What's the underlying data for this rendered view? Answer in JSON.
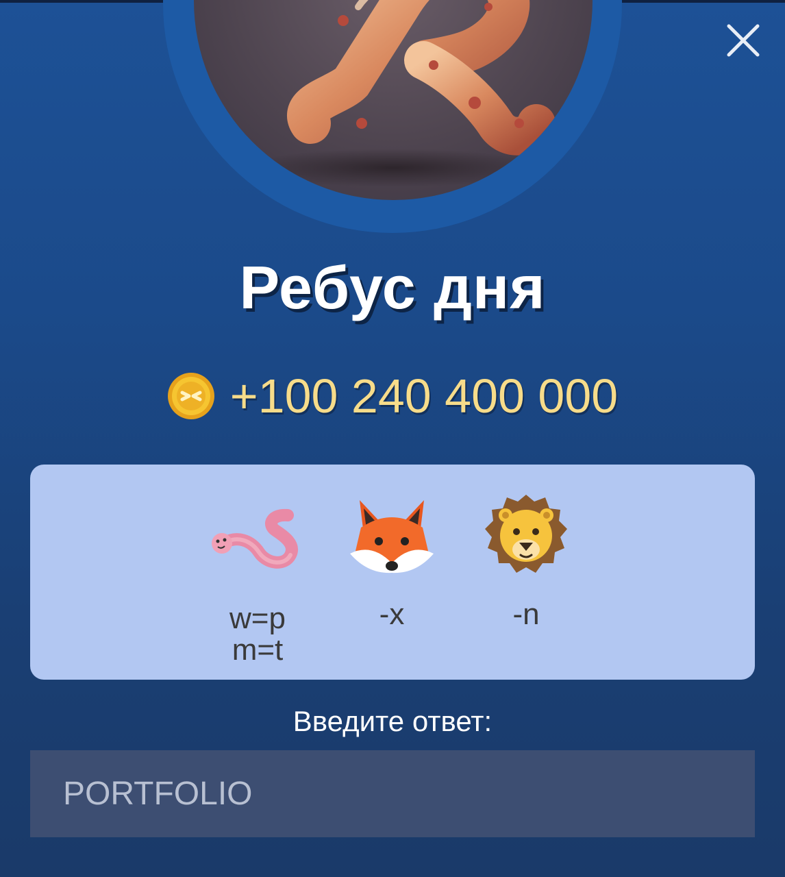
{
  "dialog": {
    "title": "Ребус дня",
    "reward_amount": "+100 240 400 000",
    "answer_label": "Введите ответ:",
    "answer_placeholder": "PORTFOLIO"
  },
  "rebus": {
    "items": [
      {
        "icon": "worm-icon",
        "hint": "w=p\nm=t"
      },
      {
        "icon": "fox-icon",
        "hint": "-x"
      },
      {
        "icon": "lion-icon",
        "hint": "-n"
      }
    ]
  },
  "colors": {
    "background": "#1b4a8a",
    "card": "#b2c7f2",
    "reward_text": "#f7dc8a",
    "input_bg": "#3d4e72"
  }
}
